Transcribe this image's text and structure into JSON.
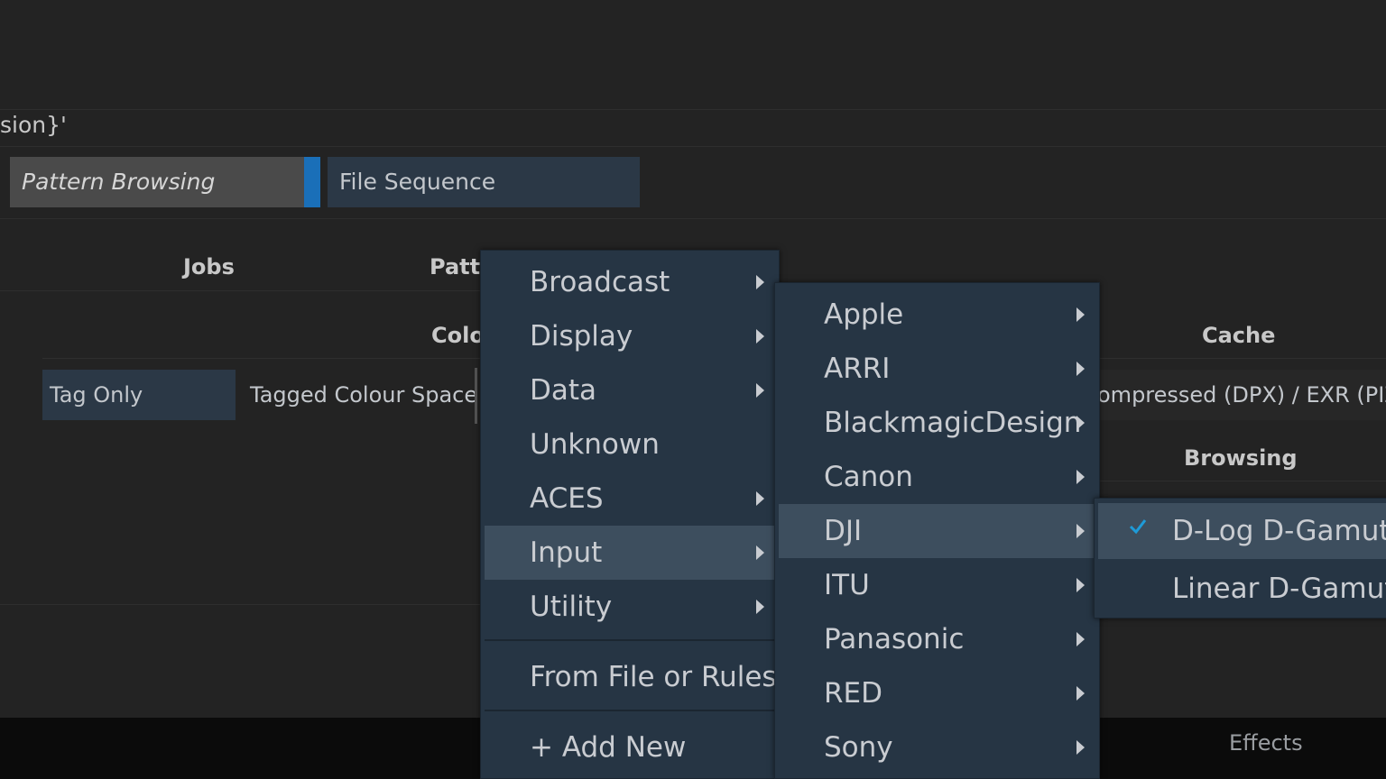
{
  "path_fragment": "sion}'",
  "tabs": {
    "pattern_browsing": "Pattern Browsing",
    "file_sequence": "File Sequence"
  },
  "columns": {
    "jobs": "Jobs",
    "pattern": "Patte",
    "colour": "Colo",
    "cache": "Cache",
    "browsing": "Browsing"
  },
  "row": {
    "tag_only": "Tag Only",
    "tagged_colour_space": "Tagged Colour Space",
    "compressed": "ompressed (DPX) / EXR (PIZ"
  },
  "bottom": {
    "effects": "Effects"
  },
  "menu_main": {
    "items": [
      "Broadcast",
      "Display",
      "Data",
      "Unknown",
      "ACES",
      "Input",
      "Utility"
    ],
    "from_file": "From File or Rules",
    "add_new": "+ Add New",
    "highlighted": "Input"
  },
  "menu_input": {
    "items": [
      "Apple",
      "ARRI",
      "BlackmagicDesign",
      "Canon",
      "DJI",
      "ITU",
      "Panasonic",
      "RED",
      "Sony"
    ],
    "highlighted": "DJI"
  },
  "menu_dji": {
    "items": [
      "D-Log D-Gamut",
      "Linear D-Gamut"
    ],
    "checked": "D-Log D-Gamut"
  },
  "colors": {
    "accent": "#1a6fb8",
    "check": "#1e9bd8",
    "menu_bg": "#263544",
    "menu_highlight": "#3d4e5e"
  }
}
